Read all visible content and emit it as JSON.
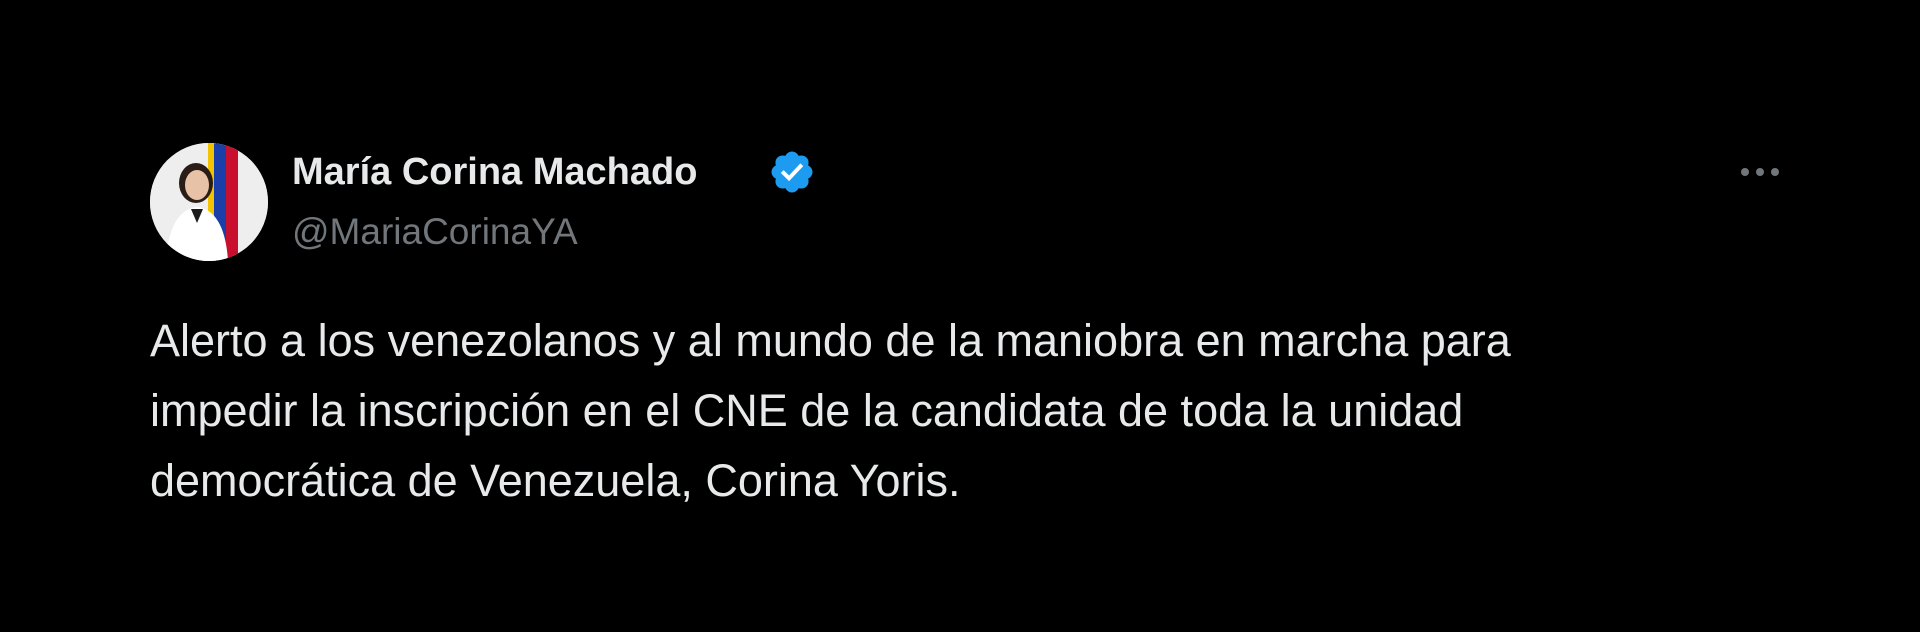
{
  "tweet": {
    "author": {
      "name": "María Corina Machado",
      "handle": "@MariaCorinaYA",
      "verified": true,
      "avatar_icon": "profile-photo"
    },
    "more_icon": "more-horizontal-icon",
    "text": "Alerto a los venezolanos y al mundo de la maniobra en marcha para\nimpedir la inscripción en el CNE de la candidata de toda la unidad\ndemocrática de Venezuela, Corina Yoris.",
    "colors": {
      "background": "#000000",
      "text": "#e7e9ea",
      "secondary": "#71767b",
      "verified": "#1d9bf0"
    }
  }
}
